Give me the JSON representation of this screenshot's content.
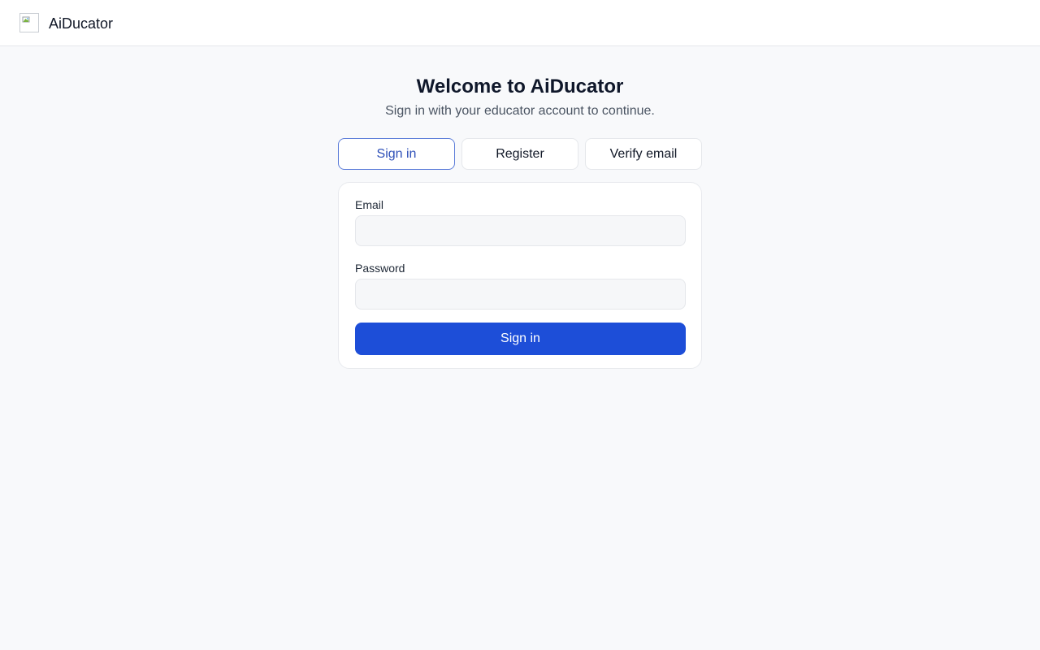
{
  "header": {
    "logo_icon": "broken-image-icon",
    "app_name": "AiDucator"
  },
  "page": {
    "title": "Welcome to AiDucator",
    "subtitle": "Sign in with your educator account to continue."
  },
  "tabs": [
    {
      "label": "Sign in",
      "active": true
    },
    {
      "label": "Register",
      "active": false
    },
    {
      "label": "Verify email",
      "active": false
    }
  ],
  "form": {
    "email": {
      "label": "Email",
      "value": "",
      "placeholder": ""
    },
    "password": {
      "label": "Password",
      "value": "",
      "placeholder": ""
    },
    "submit_label": "Sign in"
  },
  "colors": {
    "accent": "#1d4ed8",
    "active_tab_border": "#5b7cd9",
    "background": "#f8f9fb"
  }
}
